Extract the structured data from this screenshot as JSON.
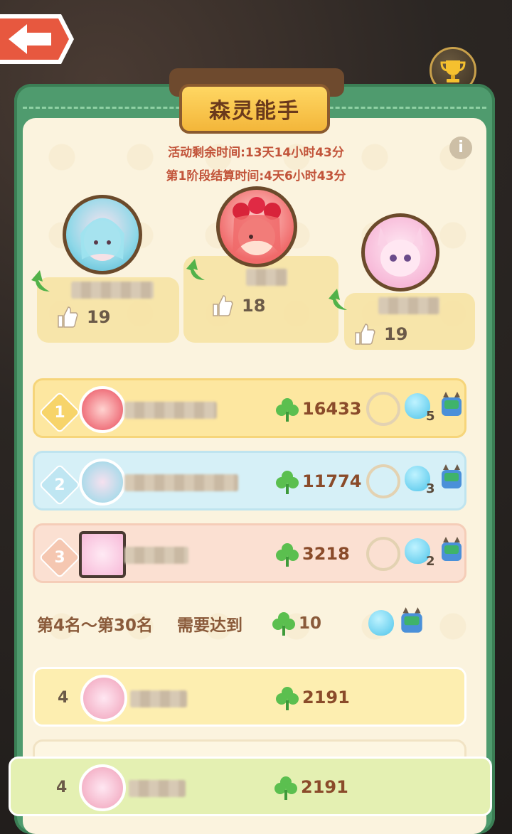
{
  "title": "森灵能手",
  "timer": {
    "remaining": "活动剩余时间:13天14小时43分",
    "stage": "第1阶段结算时间:4天6小时43分"
  },
  "podium": [
    {
      "likes": "19"
    },
    {
      "likes": "18"
    },
    {
      "likes": "19"
    }
  ],
  "ranking": [
    {
      "rank": "1",
      "score": "16433",
      "reward_count": "5"
    },
    {
      "rank": "2",
      "score": "11774",
      "reward_count": "3"
    },
    {
      "rank": "3",
      "score": "3218",
      "reward_count": "2"
    }
  ],
  "requirement": {
    "range": "第4名～第30名",
    "label": "需要达到",
    "value": "10"
  },
  "list_rows": [
    {
      "rank": "4",
      "score": "2191"
    }
  ],
  "self_row": {
    "rank": "4",
    "score": "2191"
  },
  "colors": {
    "frame": "#4f9b6e",
    "panel": "#fbf3de",
    "gold_row": "#fde7a0",
    "blue_row": "#d6f0f7",
    "peach_row": "#fbe0d2",
    "clover": "#5bbf4f",
    "timer_text": "#c2543a"
  }
}
